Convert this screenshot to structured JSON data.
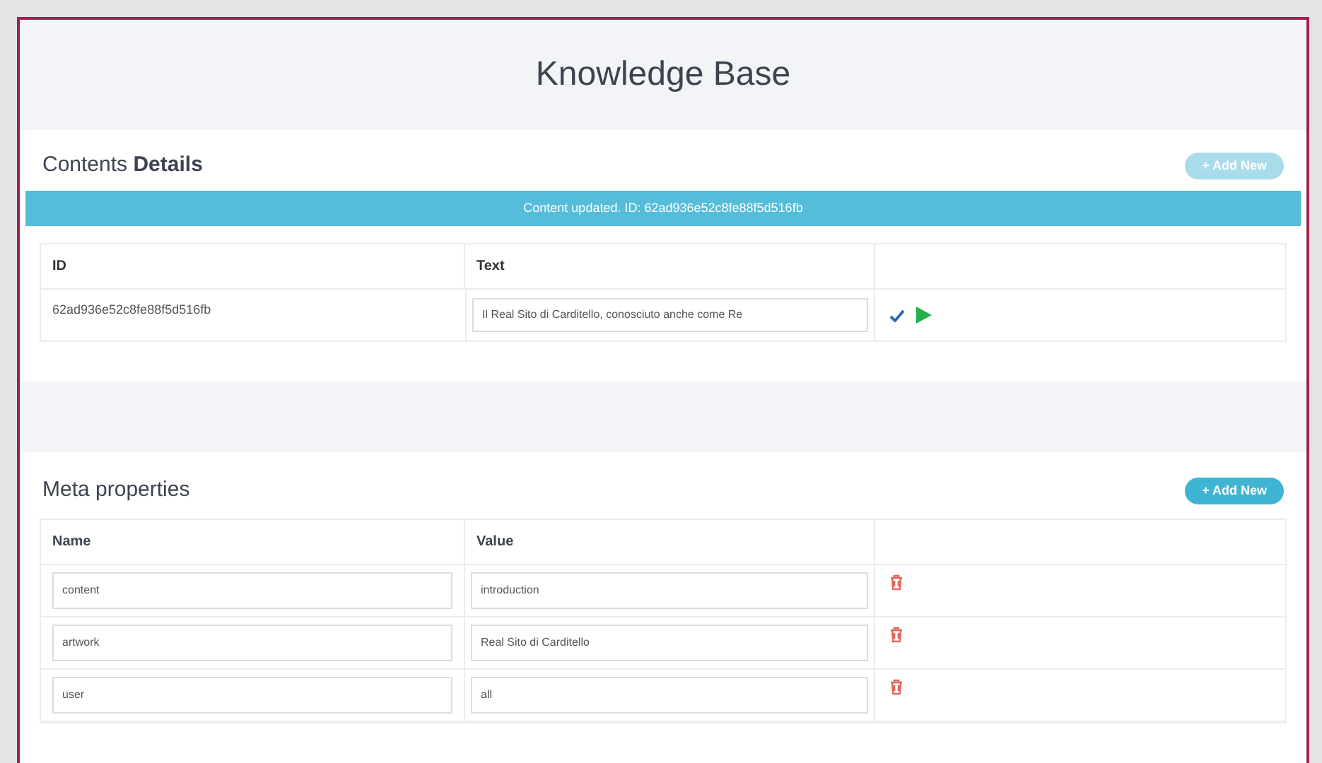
{
  "page_title": "Knowledge Base",
  "contents": {
    "title": "Contents **Details**",
    "add_button": {
      "label": "+ Add New",
      "disabled": true
    },
    "alert": "Content updated. ID: 62ad936e52c8fe88f5d516fb",
    "columns": [
      "ID",
      "Text"
    ],
    "rows": [
      {
        "id": "62ad936e52c8fe88f5d516fb",
        "text": "Il Real Sito di Carditello, conosciuto anche come Re"
      }
    ]
  },
  "meta": {
    "title": "Meta properties",
    "add_button": {
      "label": "+ Add New",
      "disabled": false
    },
    "columns": [
      "Name",
      "Value"
    ],
    "rows": [
      {
        "name": "content",
        "value": "introduction"
      },
      {
        "name": "artwork",
        "value": "Real Sito di Carditello"
      },
      {
        "name": "user",
        "value": "all"
      }
    ]
  }
}
